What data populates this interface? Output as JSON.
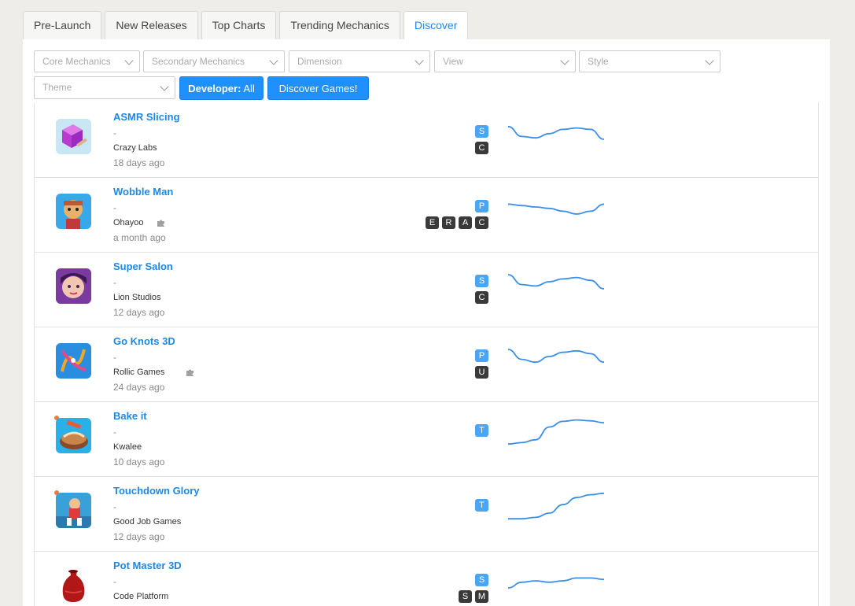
{
  "tabs": [
    {
      "label": "Pre-Launch",
      "active": false
    },
    {
      "label": "New Releases",
      "active": false
    },
    {
      "label": "Top Charts",
      "active": false
    },
    {
      "label": "Trending Mechanics",
      "active": false
    },
    {
      "label": "Discover",
      "active": true
    }
  ],
  "filters": {
    "core_mechanics": "Core Mechanics",
    "secondary_mechanics": "Secondary Mechanics",
    "dimension": "Dimension",
    "view": "View",
    "style": "Style",
    "theme": "Theme",
    "developer_label": "Developer:",
    "developer_value": "All",
    "discover_button": "Discover Games!"
  },
  "games": [
    {
      "title": "ASMR Slicing",
      "subtitle": "-",
      "developer": "Crazy Labs",
      "date": "18 days ago",
      "puzzle": false,
      "new": false,
      "top_badges": [
        "S"
      ],
      "bottom_badges": [
        "C"
      ],
      "trend": [
        0.7,
        0.35,
        0.3,
        0.45,
        0.6,
        0.65,
        0.6,
        0.25
      ]
    },
    {
      "title": "Wobble Man",
      "subtitle": "-",
      "developer": "Ohayoo",
      "date": "a month ago",
      "puzzle": true,
      "new": false,
      "top_badges": [
        "P"
      ],
      "bottom_badges": [
        "E",
        "R",
        "A",
        "C"
      ],
      "trend": [
        0.6,
        0.55,
        0.5,
        0.45,
        0.35,
        0.25,
        0.35,
        0.6
      ]
    },
    {
      "title": "Super Salon",
      "subtitle": "-",
      "developer": "Lion Studios",
      "date": "12 days ago",
      "puzzle": false,
      "new": false,
      "top_badges": [
        "S"
      ],
      "bottom_badges": [
        "C"
      ],
      "trend": [
        0.75,
        0.4,
        0.35,
        0.5,
        0.6,
        0.65,
        0.55,
        0.25
      ]
    },
    {
      "title": "Go Knots 3D",
      "subtitle": "-",
      "developer": "Rollic Games",
      "date": "24 days ago",
      "puzzle": true,
      "new": false,
      "top_badges": [
        "P"
      ],
      "bottom_badges": [
        "U"
      ],
      "trend": [
        0.75,
        0.4,
        0.3,
        0.5,
        0.65,
        0.7,
        0.6,
        0.3
      ]
    },
    {
      "title": "Bake it",
      "subtitle": "-",
      "developer": "Kwalee",
      "date": "10 days ago",
      "puzzle": false,
      "new": true,
      "top_badges": [
        "T"
      ],
      "bottom_badges": [],
      "trend": [
        0.05,
        0.1,
        0.2,
        0.65,
        0.85,
        0.9,
        0.87,
        0.8
      ]
    },
    {
      "title": "Touchdown Glory",
      "subtitle": "-",
      "developer": "Good Job Games",
      "date": "12 days ago",
      "puzzle": false,
      "new": true,
      "top_badges": [
        "T"
      ],
      "bottom_badges": [],
      "trend": [
        0.05,
        0.05,
        0.1,
        0.25,
        0.55,
        0.8,
        0.9,
        0.95
      ]
    },
    {
      "title": "Pot Master 3D",
      "subtitle": "-",
      "developer": "Code Platform",
      "date": "",
      "puzzle": false,
      "new": false,
      "top_badges": [
        "S"
      ],
      "bottom_badges": [
        "S",
        "M"
      ],
      "trend": [
        0.25,
        0.45,
        0.5,
        0.45,
        0.5,
        0.6,
        0.6,
        0.55
      ]
    }
  ],
  "colors": {
    "accent": "#1e88e5",
    "badge_blue": "#4aa6f5",
    "badge_dark": "#3a3a3a",
    "trend_line": "#3b8fe8"
  }
}
